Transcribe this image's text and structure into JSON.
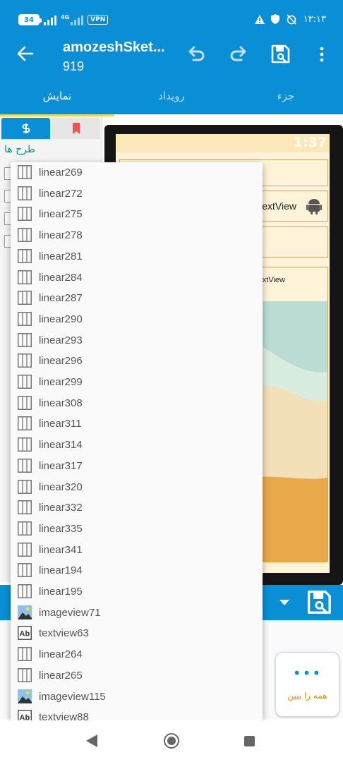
{
  "status_bar": {
    "battery": "34",
    "network": "4G",
    "vpn": "VPN",
    "time": "۱۳:۱۳"
  },
  "toolbar": {
    "title": "amozeshSket...",
    "subtitle": "919"
  },
  "tabs": [
    {
      "label": "نمایش",
      "active": true
    },
    {
      "label": "رویداد",
      "active": false
    },
    {
      "label": "جزء",
      "active": false
    }
  ],
  "palette": {
    "title": "طرح ها"
  },
  "preview": {
    "time": "1:37",
    "text1": "extView",
    "text2": "xtView"
  },
  "see_all": {
    "label": "همه را ببین"
  },
  "dropdown": {
    "items": [
      {
        "label": "linear269",
        "icon": "linear-layout-icon"
      },
      {
        "label": "linear272",
        "icon": "linear-layout-icon"
      },
      {
        "label": "linear275",
        "icon": "linear-layout-icon"
      },
      {
        "label": "linear278",
        "icon": "linear-layout-icon"
      },
      {
        "label": "linear281",
        "icon": "linear-layout-icon"
      },
      {
        "label": "linear284",
        "icon": "linear-layout-icon"
      },
      {
        "label": "linear287",
        "icon": "linear-layout-icon"
      },
      {
        "label": "linear290",
        "icon": "linear-layout-icon"
      },
      {
        "label": "linear293",
        "icon": "linear-layout-icon"
      },
      {
        "label": "linear296",
        "icon": "linear-layout-icon"
      },
      {
        "label": "linear299",
        "icon": "linear-layout-icon"
      },
      {
        "label": "linear308",
        "icon": "linear-layout-icon"
      },
      {
        "label": "linear311",
        "icon": "linear-layout-icon"
      },
      {
        "label": "linear314",
        "icon": "linear-layout-icon"
      },
      {
        "label": "linear317",
        "icon": "linear-layout-icon"
      },
      {
        "label": "linear320",
        "icon": "linear-layout-icon"
      },
      {
        "label": "linear332",
        "icon": "linear-layout-icon"
      },
      {
        "label": "linear335",
        "icon": "linear-layout-icon"
      },
      {
        "label": "linear341",
        "icon": "linear-layout-icon"
      },
      {
        "label": "linear194",
        "icon": "linear-layout-icon"
      },
      {
        "label": "linear195",
        "icon": "linear-layout-icon"
      },
      {
        "label": "imageview71",
        "icon": "image-icon"
      },
      {
        "label": "textview63",
        "icon": "text-icon"
      },
      {
        "label": "linear264",
        "icon": "linear-layout-icon"
      },
      {
        "label": "linear265",
        "icon": "linear-layout-icon"
      },
      {
        "label": "imageview115",
        "icon": "image-icon"
      },
      {
        "label": "textview88",
        "icon": "text-icon"
      }
    ]
  },
  "colors": {
    "primary": "#0a8fd6",
    "accent": "#f5d54a",
    "palette_title": "#0a8f84",
    "see_all_label": "#e08a00"
  }
}
